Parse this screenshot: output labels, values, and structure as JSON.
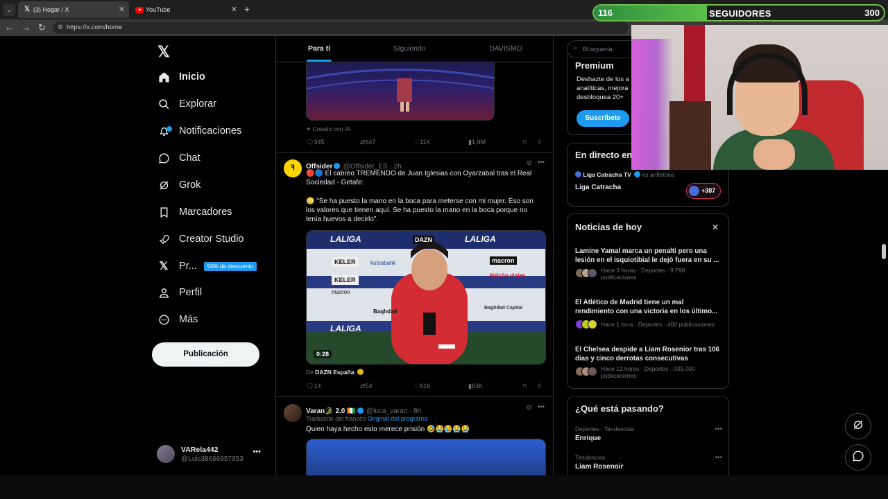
{
  "browser": {
    "tabs": [
      {
        "title": "(3) Hogar / X",
        "icon": "x-logo-icon",
        "active": true
      },
      {
        "title": "YouTube",
        "icon": "youtube-icon",
        "active": false
      }
    ],
    "url": "https://x.com/home"
  },
  "overlay": {
    "followers_current": "116",
    "followers_label": "SEGUIDORES",
    "followers_goal": "300",
    "progress_fraction": 0.39
  },
  "nav": {
    "items": [
      {
        "label": "Inicio",
        "icon": "home-icon"
      },
      {
        "label": "Explorar",
        "icon": "search-icon"
      },
      {
        "label": "Notificaciones",
        "icon": "bell-icon"
      },
      {
        "label": "Chat",
        "icon": "chat-icon"
      },
      {
        "label": "Grok",
        "icon": "grok-icon"
      },
      {
        "label": "Marcadores",
        "icon": "bookmark-icon"
      },
      {
        "label": "Creator Studio",
        "icon": "rocket-icon"
      },
      {
        "label": "Pr...",
        "icon": "x-logo-icon",
        "promo": "50% de descuento"
      },
      {
        "label": "Perfil",
        "icon": "person-icon"
      },
      {
        "label": "Más",
        "icon": "more-circle-icon"
      }
    ],
    "post_button": "Publicación",
    "account": {
      "name": "VARela442",
      "handle": "@Luis38666957953"
    }
  },
  "feed": {
    "tabs": [
      "Para ti",
      "Siguiendo",
      "DAVISMO"
    ],
    "post1": {
      "ai_label": "Creado con IA",
      "replies": "345",
      "reposts": "647",
      "likes": "11K",
      "views": "1,9M"
    },
    "post2": {
      "name": "Offsider",
      "handle": "@Offsider_ES · 2h",
      "text1": "🔴🔵 El cabreo TREMENDO de Juan Iglesias con Oyarzabal tras el Real Sociedad - Getafe:",
      "text2": "😳 \"Se ha puesto la mano en la boca para meterse con mi mujer. Eso son los valores que tienen aquí. Se ha puesto la mano en la boca porque no tenía huevos a decirlo\".",
      "video_time": "0:28",
      "source_prefix": "De",
      "source": "DAZN España",
      "replies": "14",
      "reposts": "54",
      "likes": "616",
      "views": "63K",
      "sponsor_boards": [
        "LALIGA",
        "KELER",
        "kutxabank",
        "macron",
        "DAZN",
        "Baqhdad",
        "Halcón viajes",
        "Baghdad Capital"
      ]
    },
    "post3": {
      "name": "Varan🐊 2.0 🇨🇮",
      "handle": "@luca_varan · 8h",
      "translated": "Traducido del francés",
      "original": "Original del programa",
      "text": "Quien haya hecho esto merece prisión 🤣😭😭😭😭"
    }
  },
  "sidebar": {
    "search_placeholder": "Búsqueda",
    "premium": {
      "title": "Premium",
      "line1": "Deshazte de los a",
      "line2": "analíticas, mejora",
      "line3": "desbloquea 20+",
      "button": "Suscríbete"
    },
    "live": {
      "title": "En directo en",
      "host_line": "Liga Catracha TV",
      "host_suffix": "es anfitriona",
      "space_title": "Liga Catracha",
      "listeners": "+387"
    },
    "news": {
      "title": "Noticias de hoy",
      "items": [
        {
          "headline": "Lamine Yamal marca un penalti pero una lesión en el isquiotibial le dejó fuera en su ...",
          "meta": "Hace 3 horas · Deportes · 9.798 publicaciones"
        },
        {
          "headline": "El Atlético de Madrid tiene un mal rendimiento con una victoria en los último...",
          "meta": "Hace 1 hora · Deportes · 460 publicaciones"
        },
        {
          "headline": "El Chelsea despide a Liam Rosenior tras 106 días y cinco derrotas consecutivas",
          "meta": "Hace 12 horas · Deportes · 339.700 publicaciones"
        }
      ]
    },
    "trends": {
      "title": "¿Qué está pasando?",
      "items": [
        {
          "category": "Deportes · Tendencias",
          "topic": "Enrique"
        },
        {
          "category": "Tendencias",
          "topic": "Liam Rosenoir"
        }
      ]
    }
  },
  "colors": {
    "accent": "#1d9bf0",
    "border": "#2f3336",
    "muted": "#71767b",
    "followers_green": "#5ac04a"
  }
}
